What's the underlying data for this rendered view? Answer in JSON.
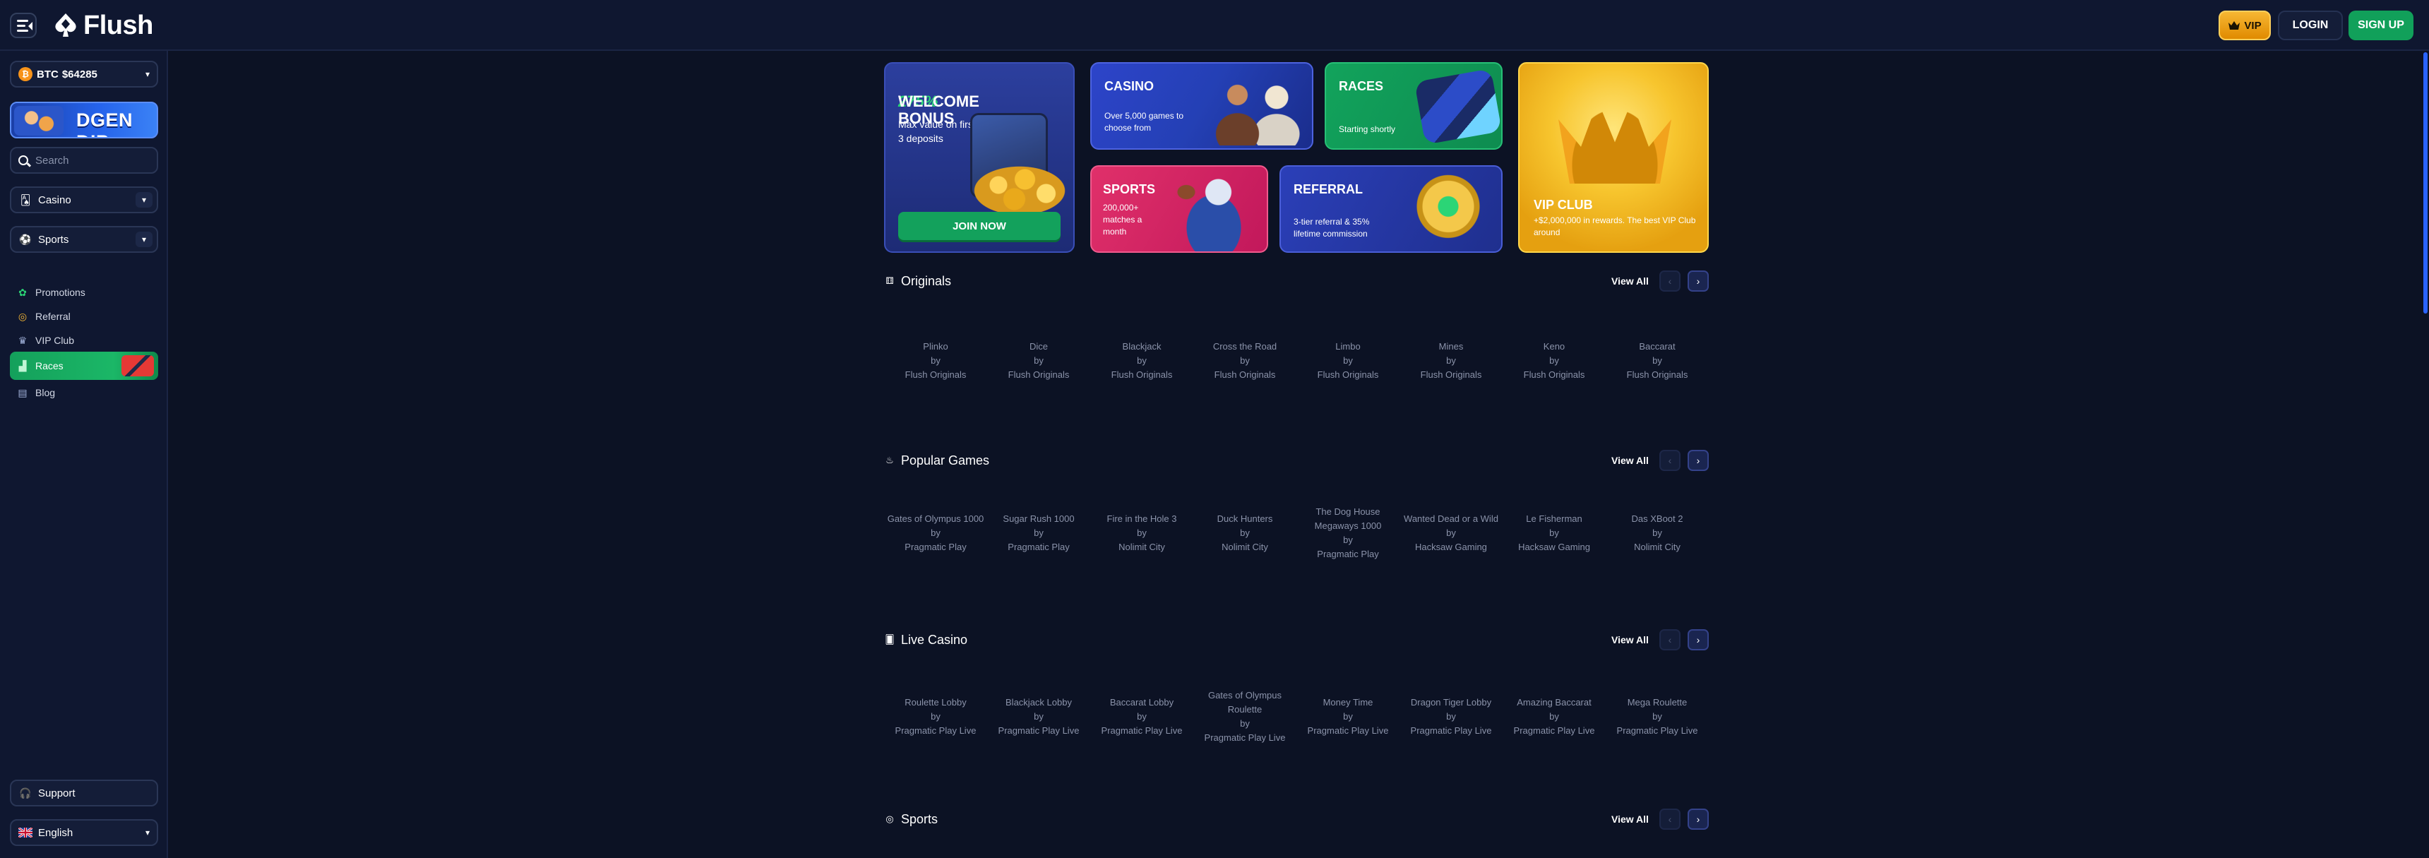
{
  "header": {
    "brand": "Flush",
    "vip_label": "VIP",
    "login_label": "LOGIN",
    "signup_label": "SIGN UP"
  },
  "sidebar": {
    "balance": {
      "currency": "BTC",
      "value": "$64285"
    },
    "banner_text": "DGEN DIP",
    "search_placeholder": "Search",
    "dropdowns": [
      {
        "label": "Casino",
        "icon": "cards-icon"
      },
      {
        "label": "Sports",
        "icon": "soccer-ball-icon"
      }
    ],
    "links": [
      {
        "label": "Promotions",
        "icon": "gift-icon"
      },
      {
        "label": "Referral",
        "icon": "coin-icon"
      },
      {
        "label": "VIP Club",
        "icon": "crown-icon"
      },
      {
        "label": "Races",
        "icon": "podium-icon"
      },
      {
        "label": "Blog",
        "icon": "newspaper-icon"
      }
    ],
    "support_label": "Support",
    "language_label": "English"
  },
  "promos": {
    "welcome": {
      "pct": "275%",
      "title": "WELCOME BONUS",
      "text": "Max value on first 3 deposits",
      "button": "JOIN NOW"
    },
    "casino": {
      "title": "CASINO",
      "text": "Over 5,000 games to choose from"
    },
    "races": {
      "title": "RACES",
      "text": "Starting shortly"
    },
    "vip": {
      "title": "VIP CLUB",
      "text": "+$2,000,000 in rewards. The best VIP Club around"
    },
    "sports": {
      "title": "SPORTS",
      "text": "200,000+ matches a month"
    },
    "referral": {
      "title": "REFERRAL",
      "text": "3-tier referral & 35% lifetime commission"
    }
  },
  "sections": [
    {
      "title": "Originals",
      "icon": "dice-icon",
      "view_all": "View All",
      "games": [
        {
          "name": "Plinko",
          "by": "by",
          "provider": "Flush Originals"
        },
        {
          "name": "Dice",
          "by": "by",
          "provider": "Flush Originals"
        },
        {
          "name": "Blackjack",
          "by": "by",
          "provider": "Flush Originals"
        },
        {
          "name": "Cross the Road",
          "by": "by",
          "provider": "Flush Originals"
        },
        {
          "name": "Limbo",
          "by": "by",
          "provider": "Flush Originals"
        },
        {
          "name": "Mines",
          "by": "by",
          "provider": "Flush Originals"
        },
        {
          "name": "Keno",
          "by": "by",
          "provider": "Flush Originals"
        },
        {
          "name": "Baccarat",
          "by": "by",
          "provider": "Flush Originals"
        }
      ]
    },
    {
      "title": "Popular Games",
      "icon": "flame-icon",
      "view_all": "View All",
      "games": [
        {
          "name": "Gates of Olympus 1000",
          "by": "by",
          "provider": "Pragmatic Play"
        },
        {
          "name": "Sugar Rush 1000",
          "by": "by",
          "provider": "Pragmatic Play"
        },
        {
          "name": "Fire in the Hole 3",
          "by": "by",
          "provider": "Nolimit City"
        },
        {
          "name": "Duck Hunters",
          "by": "by",
          "provider": "Nolimit City"
        },
        {
          "name": "The Dog House Megaways 1000",
          "by": "by",
          "provider": "Pragmatic Play"
        },
        {
          "name": "Wanted Dead or a Wild",
          "by": "by",
          "provider": "Hacksaw Gaming"
        },
        {
          "name": "Le Fisherman",
          "by": "by",
          "provider": "Hacksaw Gaming"
        },
        {
          "name": "Das XBoot 2",
          "by": "by",
          "provider": "Nolimit City"
        }
      ]
    },
    {
      "title": "Live Casino",
      "icon": "live-cards-icon",
      "view_all": "View All",
      "games": [
        {
          "name": "Roulette Lobby",
          "by": "by",
          "provider": "Pragmatic Play Live"
        },
        {
          "name": "Blackjack Lobby",
          "by": "by",
          "provider": "Pragmatic Play Live"
        },
        {
          "name": "Baccarat Lobby",
          "by": "by",
          "provider": "Pragmatic Play Live"
        },
        {
          "name": "Gates of Olympus Roulette",
          "by": "by",
          "provider": "Pragmatic Play Live"
        },
        {
          "name": "Money Time",
          "by": "by",
          "provider": "Pragmatic Play Live"
        },
        {
          "name": "Dragon Tiger Lobby",
          "by": "by",
          "provider": "Pragmatic Play Live"
        },
        {
          "name": "Amazing Baccarat",
          "by": "by",
          "provider": "Pragmatic Play Live"
        },
        {
          "name": "Mega Roulette",
          "by": "by",
          "provider": "Pragmatic Play Live"
        }
      ]
    },
    {
      "title": "Sports",
      "icon": "soccer-ball-icon",
      "view_all": "View All",
      "games": []
    }
  ],
  "colors": {
    "background": "#0c1224",
    "panel": "#0f1730",
    "accent_green": "#11a05a",
    "vip_gold": "#f7b733",
    "nav_blue": "#1a2550"
  }
}
